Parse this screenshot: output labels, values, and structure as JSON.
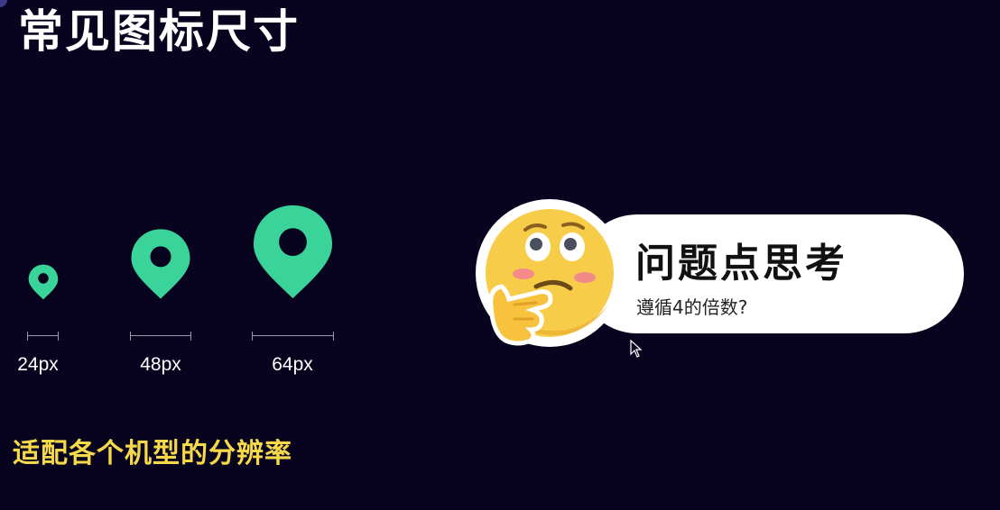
{
  "slide": {
    "title": "常见图标尺寸",
    "subtitle": "适配各个机型的分辨率",
    "accent_color": "#3ad49a",
    "subtitle_color": "#f6d84b"
  },
  "icons": [
    {
      "name": "location-pin-icon",
      "size_label": "24px"
    },
    {
      "name": "location-pin-icon",
      "size_label": "48px"
    },
    {
      "name": "location-pin-icon",
      "size_label": "64px"
    }
  ],
  "callout": {
    "icon": "thinking-face-emoji",
    "title": "问题点思考",
    "text": "遵循4的倍数?"
  }
}
